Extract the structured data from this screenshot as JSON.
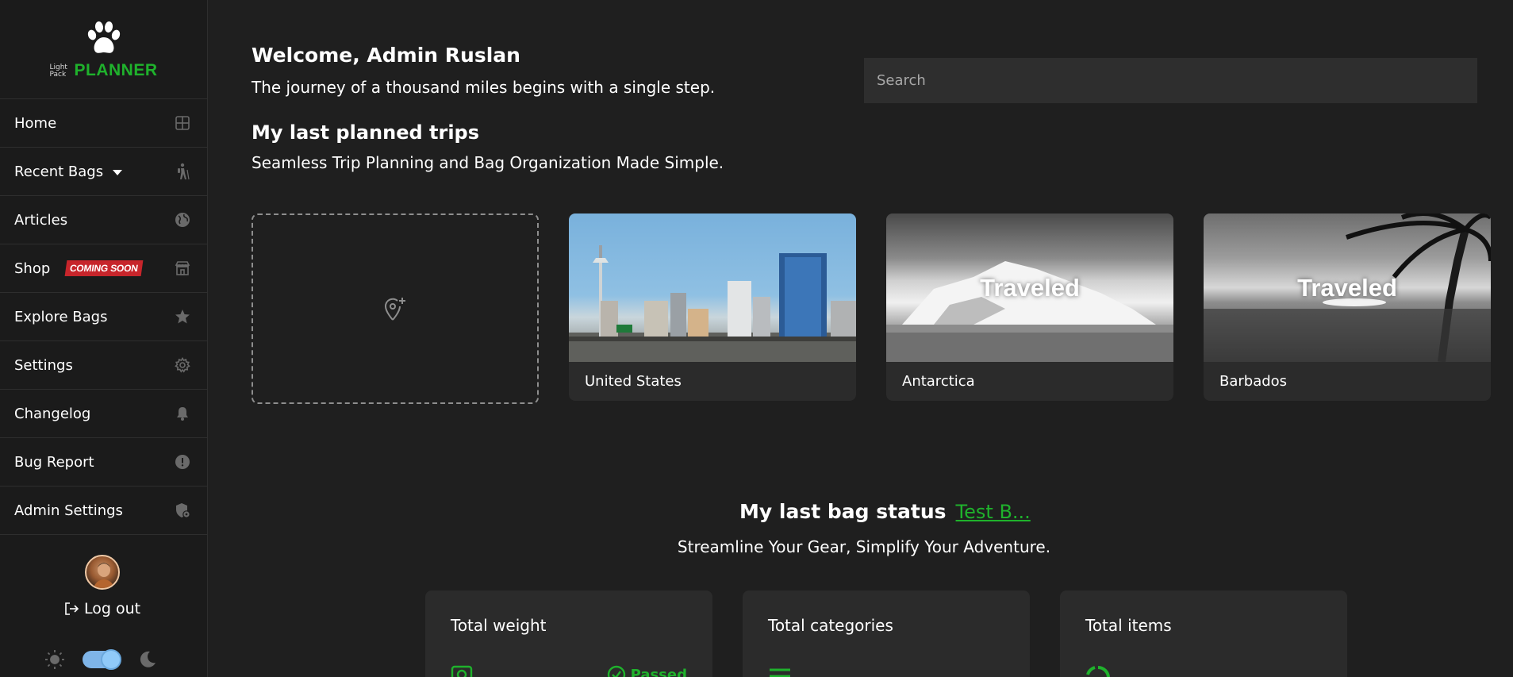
{
  "sidebar": {
    "logo": {
      "small": "Light Pack",
      "big": "PLANNER"
    },
    "items": [
      {
        "label": "Home",
        "icon": "grid-icon"
      },
      {
        "label": "Recent Bags",
        "icon": "hiker-icon"
      },
      {
        "label": "Articles",
        "icon": "globe-icon"
      },
      {
        "label": "Shop",
        "icon": "store-icon",
        "badge": "COMING SOON"
      },
      {
        "label": "Explore Bags",
        "icon": "star-icon"
      },
      {
        "label": "Settings",
        "icon": "gear-icon"
      },
      {
        "label": "Changelog",
        "icon": "bell-icon"
      },
      {
        "label": "Bug Report",
        "icon": "alert-icon"
      },
      {
        "label": "Admin Settings",
        "icon": "shield-gear-icon"
      }
    ],
    "logout_label": "Log out"
  },
  "header": {
    "welcome": "Welcome, Admin Ruslan",
    "quote": "The journey of a thousand miles begins with a single step.",
    "search_placeholder": "Search"
  },
  "trips": {
    "title": "My last planned trips",
    "subtitle": "Seamless Trip Planning and Bag Organization Made Simple.",
    "cards": [
      {
        "name": "United States",
        "overlay": ""
      },
      {
        "name": "Antarctica",
        "overlay": "Traveled"
      },
      {
        "name": "Barbados",
        "overlay": "Traveled"
      }
    ]
  },
  "bag_status": {
    "title": "My last bag status",
    "bag_link": "Test B...",
    "subtitle": "Streamline Your Gear, Simplify Your Adventure.",
    "cards": [
      {
        "label": "Total weight",
        "status": "Passed"
      },
      {
        "label": "Total categories"
      },
      {
        "label": "Total items"
      }
    ]
  },
  "colors": {
    "accent": "#1fb22c",
    "background": "#1f1f1f",
    "card": "#2b2b2b",
    "toggle": "#90caf9"
  }
}
